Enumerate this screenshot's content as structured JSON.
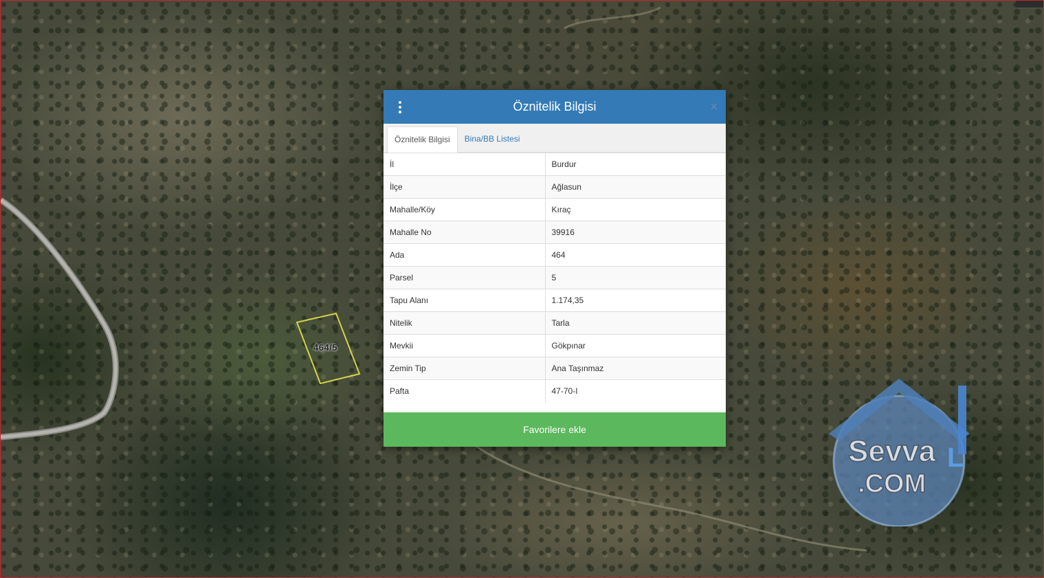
{
  "map": {
    "parcel_label": "464/5"
  },
  "watermark": {
    "text_top": "Sevva",
    "text_accent": "L",
    "text_bottom": ".COM"
  },
  "dialog": {
    "title": "Öznitelik Bilgisi",
    "close_symbol": "×",
    "tabs": [
      {
        "label": "Öznitelik Bilgisi",
        "active": true
      },
      {
        "label": "Bina/BB Listesi",
        "active": false
      }
    ],
    "rows": [
      {
        "key": "İl",
        "value": "Burdur"
      },
      {
        "key": "İlçe",
        "value": "Ağlasun"
      },
      {
        "key": "Mahalle/Köy",
        "value": "Kıraç"
      },
      {
        "key": "Mahalle No",
        "value": "39916"
      },
      {
        "key": "Ada",
        "value": "464"
      },
      {
        "key": "Parsel",
        "value": "5"
      },
      {
        "key": "Tapu Alanı",
        "value": "1.174,35"
      },
      {
        "key": "Nitelik",
        "value": "Tarla"
      },
      {
        "key": "Mevkii",
        "value": "Gökpınar"
      },
      {
        "key": "Zemin Tip",
        "value": "Ana Taşınmaz"
      },
      {
        "key": "Pafta",
        "value": "47-70-I"
      }
    ],
    "favorite_button": "Favorilere ekle"
  },
  "colors": {
    "header_blue": "#337ab7",
    "button_green": "#5cb85c",
    "tab_link": "#337ab7",
    "parcel_outline": "#d6d34a"
  },
  "icons": {
    "menu": "vertical-dots-icon",
    "close": "close-icon"
  }
}
